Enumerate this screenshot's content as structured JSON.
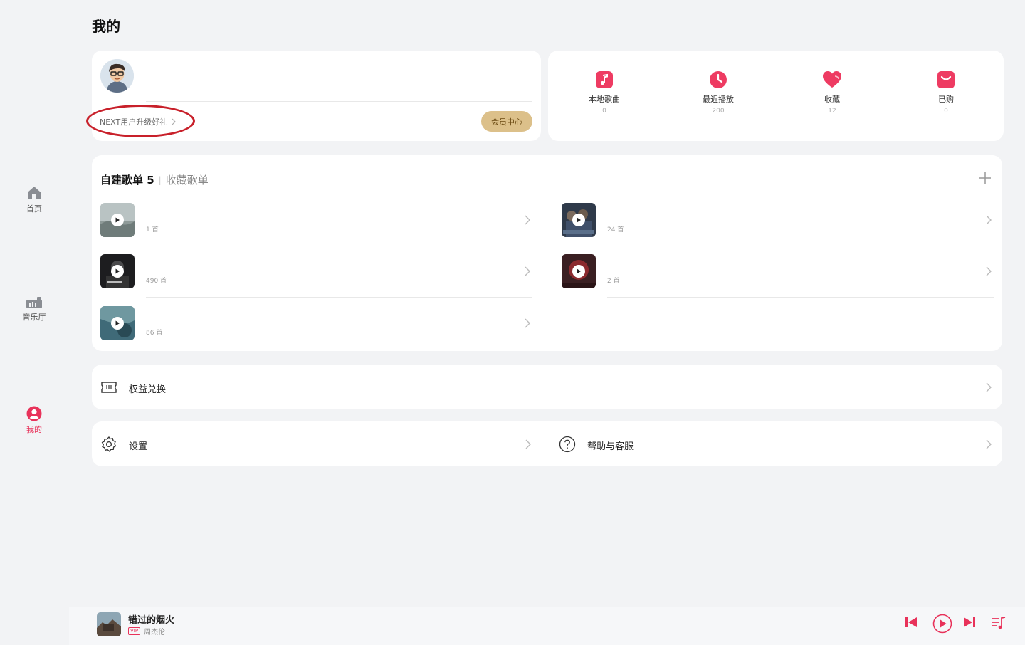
{
  "page": {
    "title": "我的"
  },
  "sidebar": {
    "items": [
      {
        "label": "首页",
        "icon": "home-icon",
        "active": false
      },
      {
        "label": "音乐厅",
        "icon": "music-hall-icon",
        "active": false
      },
      {
        "label": "我的",
        "icon": "person-icon",
        "active": true
      }
    ]
  },
  "profile": {
    "upgrade_text": "NEXT用户升级好礼",
    "vip_center_label": "会员中心"
  },
  "quick_access": [
    {
      "label": "本地歌曲",
      "count": "0",
      "icon": "music-note-icon"
    },
    {
      "label": "最近播放",
      "count": "200",
      "icon": "clock-icon"
    },
    {
      "label": "收藏",
      "count": "12",
      "icon": "heart-icon"
    },
    {
      "label": "已购",
      "count": "0",
      "icon": "bag-icon"
    }
  ],
  "playlists": {
    "tab_created": "自建歌单 5",
    "tab_separator": "|",
    "tab_collected": "收藏歌单",
    "items": [
      {
        "count": "1 首"
      },
      {
        "count": "24 首"
      },
      {
        "count": "490 首"
      },
      {
        "count": "2 首"
      },
      {
        "count": "86 首"
      }
    ]
  },
  "menu": {
    "rights_label": "权益兑换",
    "settings_label": "设置",
    "help_label": "帮助与客服"
  },
  "player": {
    "song_title": "错过的烟火",
    "vip_badge": "VIP",
    "artist": "周杰伦"
  },
  "colors": {
    "accent": "#e8325a",
    "gold": "#dcc08a",
    "background": "#f2f3f5",
    "annotation": "#c8202a"
  }
}
